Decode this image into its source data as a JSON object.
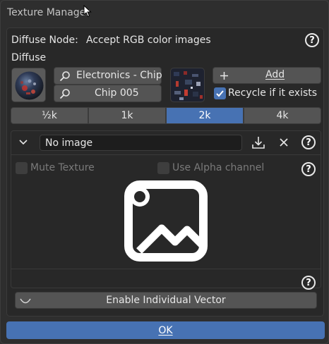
{
  "window": {
    "title": "Texture Manager"
  },
  "node": {
    "label": "Diffuse Node:",
    "description": "Accept RGB color images",
    "section_label": "Diffuse"
  },
  "search": {
    "category": "Electronics - Chip",
    "item": "Chip 005"
  },
  "actions": {
    "add_label": "Add",
    "recycle_label": "Recycle if it exists",
    "recycle_checked": true
  },
  "resolutions": {
    "options": [
      "½k",
      "1k",
      "2k",
      "4k"
    ],
    "selected": "2k"
  },
  "image": {
    "name": "No image"
  },
  "options": {
    "mute_label": "Mute Texture",
    "alpha_label": "Use Alpha channel"
  },
  "vector": {
    "label": "Enable Individual Vector"
  },
  "footer": {
    "ok_label": "OK"
  },
  "colors": {
    "accent": "#4772b3",
    "background": "#2e2e2e",
    "button": "#545454",
    "field": "#1d1d1d"
  }
}
